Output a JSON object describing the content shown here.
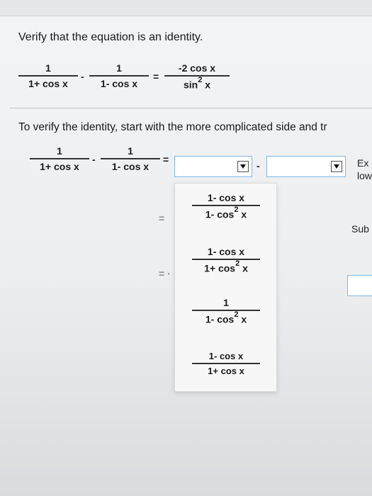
{
  "question": {
    "title": "Verify that the equation is an identity.",
    "identity": {
      "term1": {
        "num": "1",
        "den": "1+ cos x"
      },
      "minus": "-",
      "term2": {
        "num": "1",
        "den": "1- cos x"
      },
      "equals": "=",
      "rhs": {
        "num": "-2 cos x",
        "den_base": "sin",
        "den_exp": "2",
        "den_var": "x"
      }
    }
  },
  "instructions": "To verify the identity, start with the more complicated side and tr",
  "work": {
    "term1": {
      "num": "1",
      "den": "1+ cos x"
    },
    "minus": "-",
    "term2": {
      "num": "1",
      "den": "1- cos x"
    },
    "equals": "=",
    "between_dropdowns": "-",
    "side_text_1": "Ex",
    "side_text_2": "low",
    "sub_text": "Sub",
    "eq2": "=",
    "eq3": "= ·"
  },
  "dropdown_options": [
    {
      "num": "1- cos x",
      "den_base": "1- cos",
      "den_exp": "2",
      "den_var": "x"
    },
    {
      "num": "1- cos x",
      "den_base": "1+ cos",
      "den_exp": "2",
      "den_var": "x"
    },
    {
      "num": "1",
      "den_base": "1- cos",
      "den_exp": "2",
      "den_var": "x"
    },
    {
      "num": "1- cos x",
      "den_base": "1+ cos x",
      "den_exp": "",
      "den_var": ""
    }
  ]
}
